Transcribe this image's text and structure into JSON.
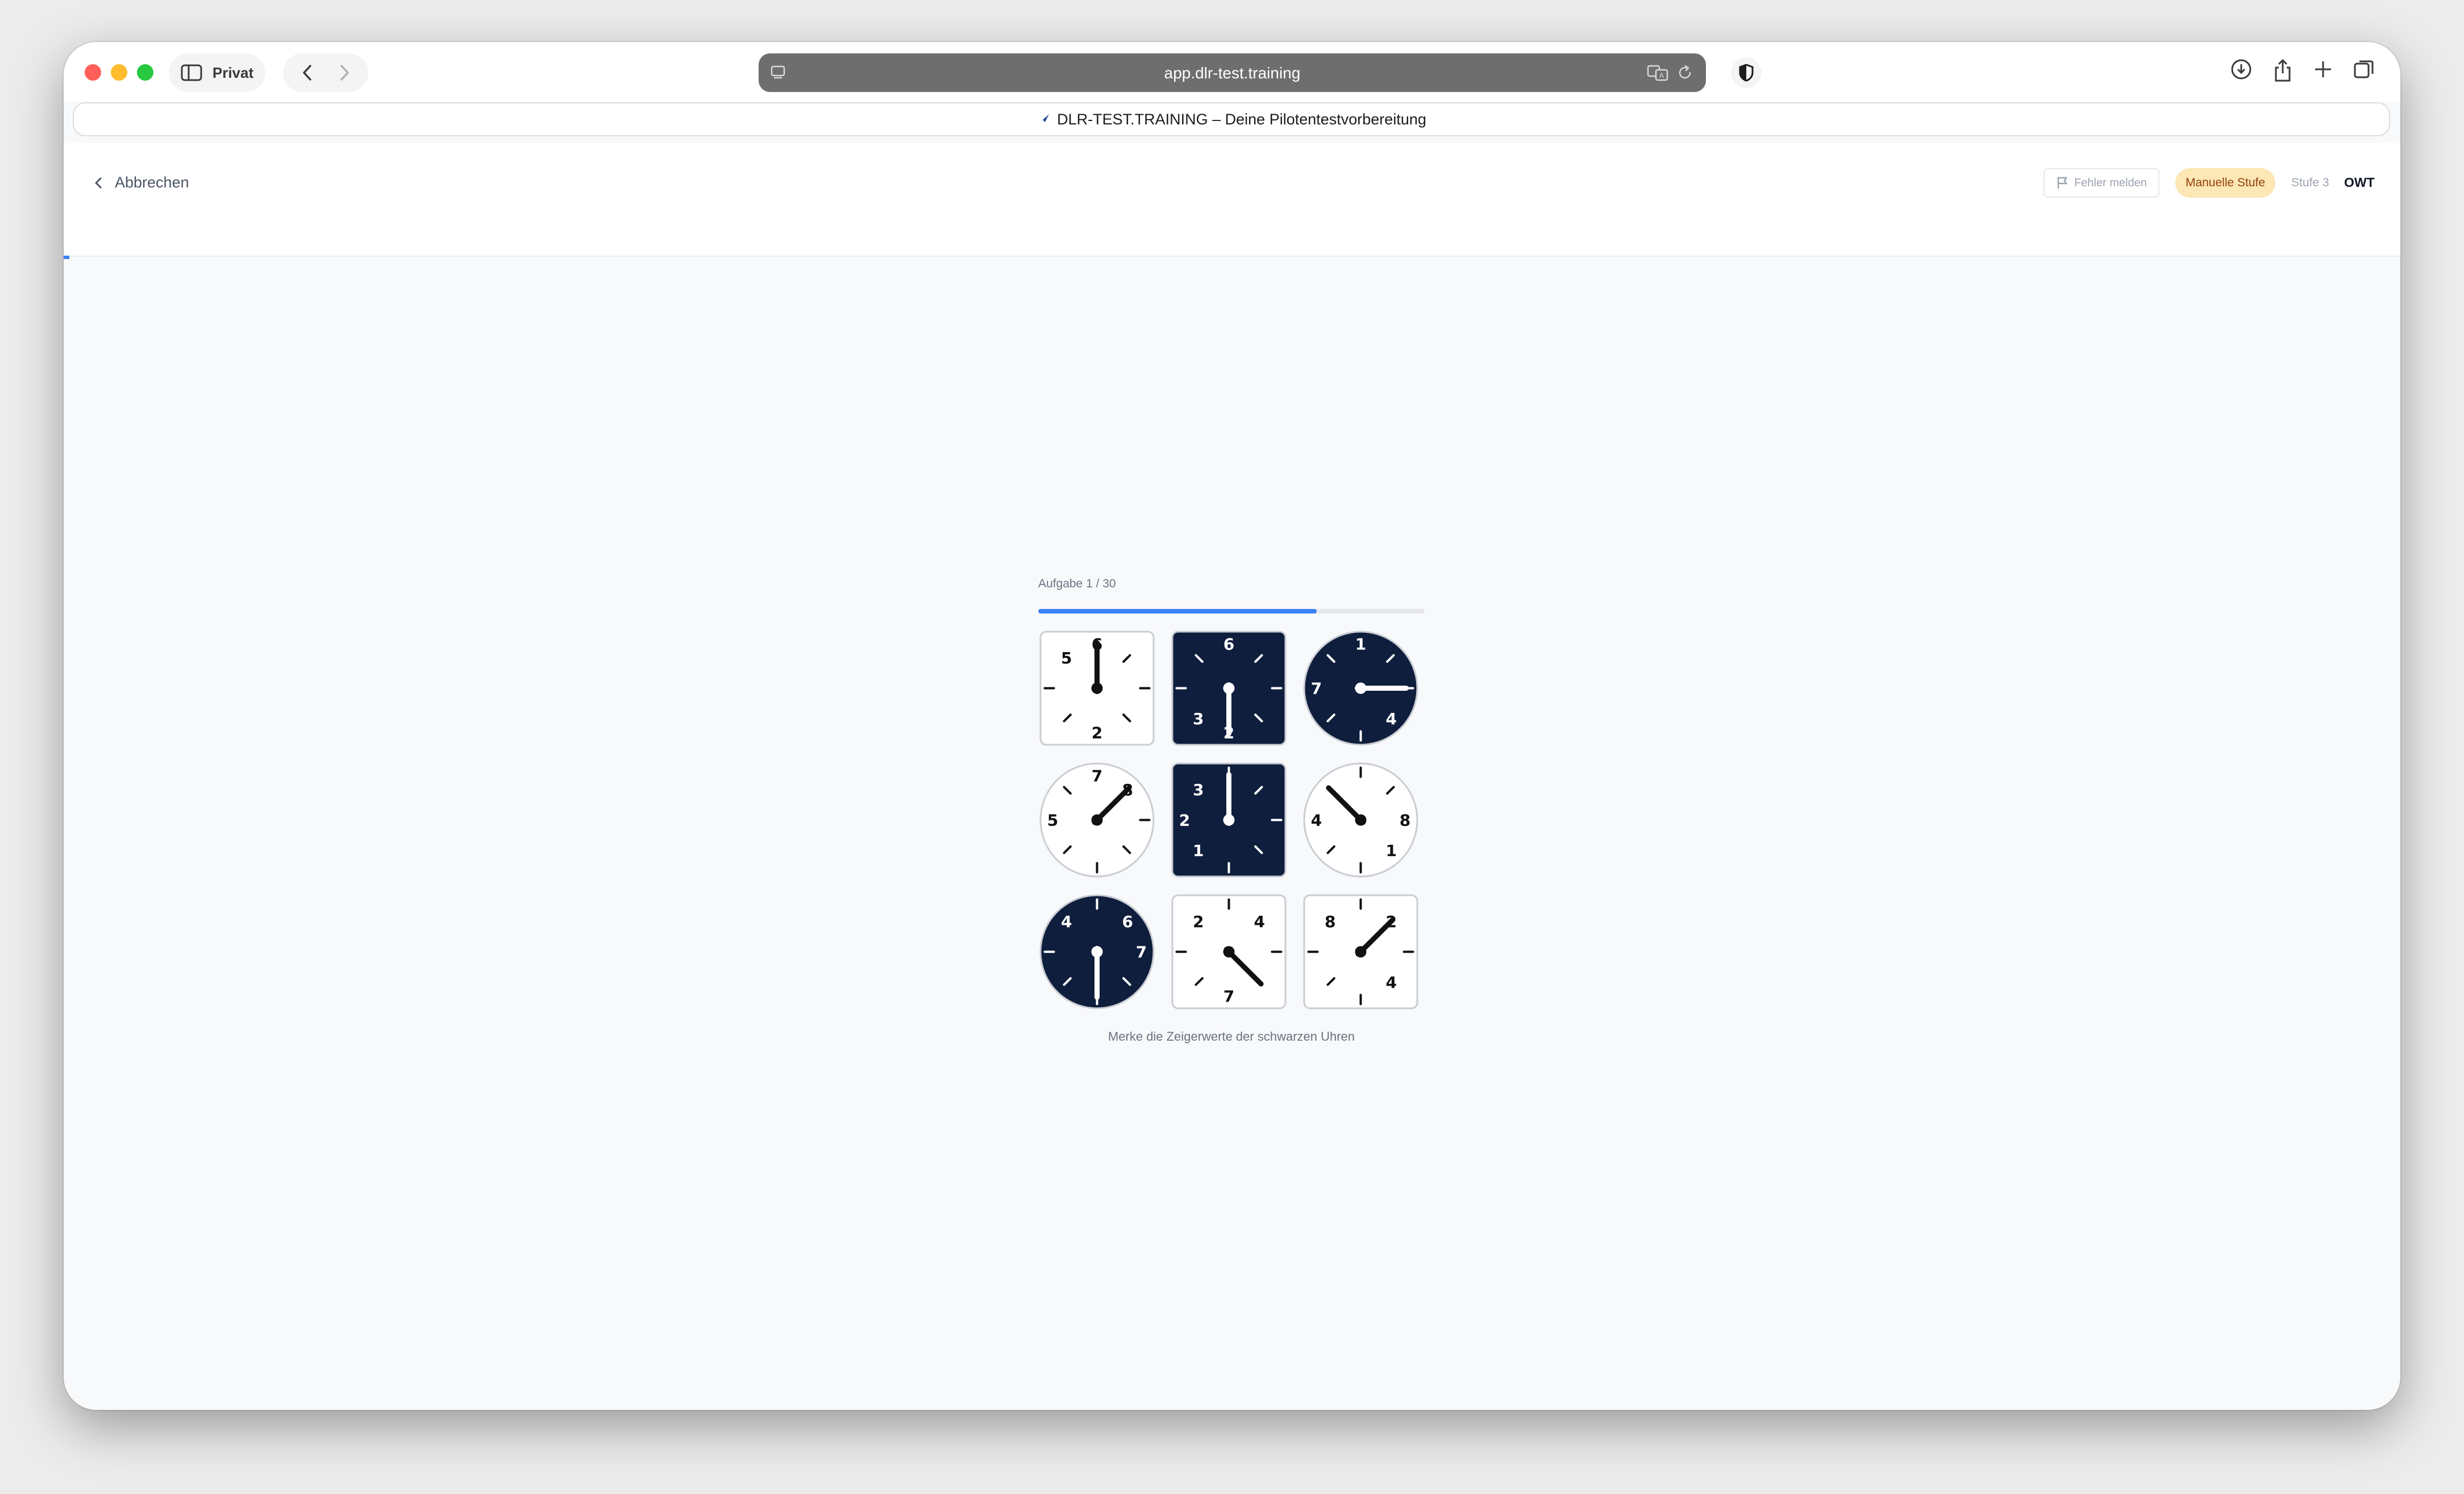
{
  "browser": {
    "private_label": "Privat",
    "url": "app.dlr-test.training",
    "tab_title": "DLR-TEST.TRAINING – Deine Pilotentestvorbereitung"
  },
  "header": {
    "cancel_label": "Abbrechen",
    "report_label": "Fehler melden",
    "badge_label": "Manuelle Stufe",
    "stage_label": "Stufe 3",
    "test_code": "OWT"
  },
  "task": {
    "label": "Aufgabe 1 / 30",
    "progress_fraction": 0.72,
    "instruction": "Merke die Zeigerwerte der schwarzen Uhren"
  },
  "colors": {
    "dark_clock": "#0f1e3d",
    "light_clock": "#ffffff",
    "accent": "#3b82f6",
    "badge_bg": "#fde7b4"
  },
  "clocks": [
    {
      "shape": "square",
      "color": "white",
      "labels": [
        {
          "n": "6",
          "pos": 0
        },
        {
          "n": "2",
          "pos": 6
        },
        {
          "n": "5",
          "pos": 10.5
        }
      ],
      "hand": 0
    },
    {
      "shape": "square",
      "color": "black",
      "labels": [
        {
          "n": "6",
          "pos": 0
        },
        {
          "n": "2",
          "pos": 6
        },
        {
          "n": "3",
          "pos": 7.5
        }
      ],
      "hand": 6
    },
    {
      "shape": "round",
      "color": "black",
      "labels": [
        {
          "n": "1",
          "pos": 0
        },
        {
          "n": "4",
          "pos": 4.5
        },
        {
          "n": "7",
          "pos": 9
        }
      ],
      "hand": 3
    },
    {
      "shape": "round",
      "color": "white",
      "labels": [
        {
          "n": "7",
          "pos": 0
        },
        {
          "n": "8",
          "pos": 1.5
        },
        {
          "n": "5",
          "pos": 9
        }
      ],
      "hand": 1.5
    },
    {
      "shape": "square",
      "color": "black",
      "labels": [
        {
          "n": "3",
          "pos": 10.5
        },
        {
          "n": "2",
          "pos": 9
        },
        {
          "n": "1",
          "pos": 7.5
        }
      ],
      "hand": 0
    },
    {
      "shape": "round",
      "color": "white",
      "labels": [
        {
          "n": "8",
          "pos": 3
        },
        {
          "n": "1",
          "pos": 4.5
        },
        {
          "n": "4",
          "pos": 9
        }
      ],
      "hand": 10.5
    },
    {
      "shape": "round",
      "color": "black",
      "labels": [
        {
          "n": "6",
          "pos": 1.5
        },
        {
          "n": "7",
          "pos": 3
        },
        {
          "n": "4",
          "pos": 10.5
        }
      ],
      "hand": 6
    },
    {
      "shape": "square",
      "color": "white",
      "labels": [
        {
          "n": "4",
          "pos": 1.5
        },
        {
          "n": "7",
          "pos": 6
        },
        {
          "n": "2",
          "pos": 10.5
        }
      ],
      "hand": 4.5
    },
    {
      "shape": "square",
      "color": "white",
      "labels": [
        {
          "n": "2",
          "pos": 1.5
        },
        {
          "n": "4",
          "pos": 4.5
        },
        {
          "n": "8",
          "pos": 10.5
        }
      ],
      "hand": 1.5
    }
  ]
}
